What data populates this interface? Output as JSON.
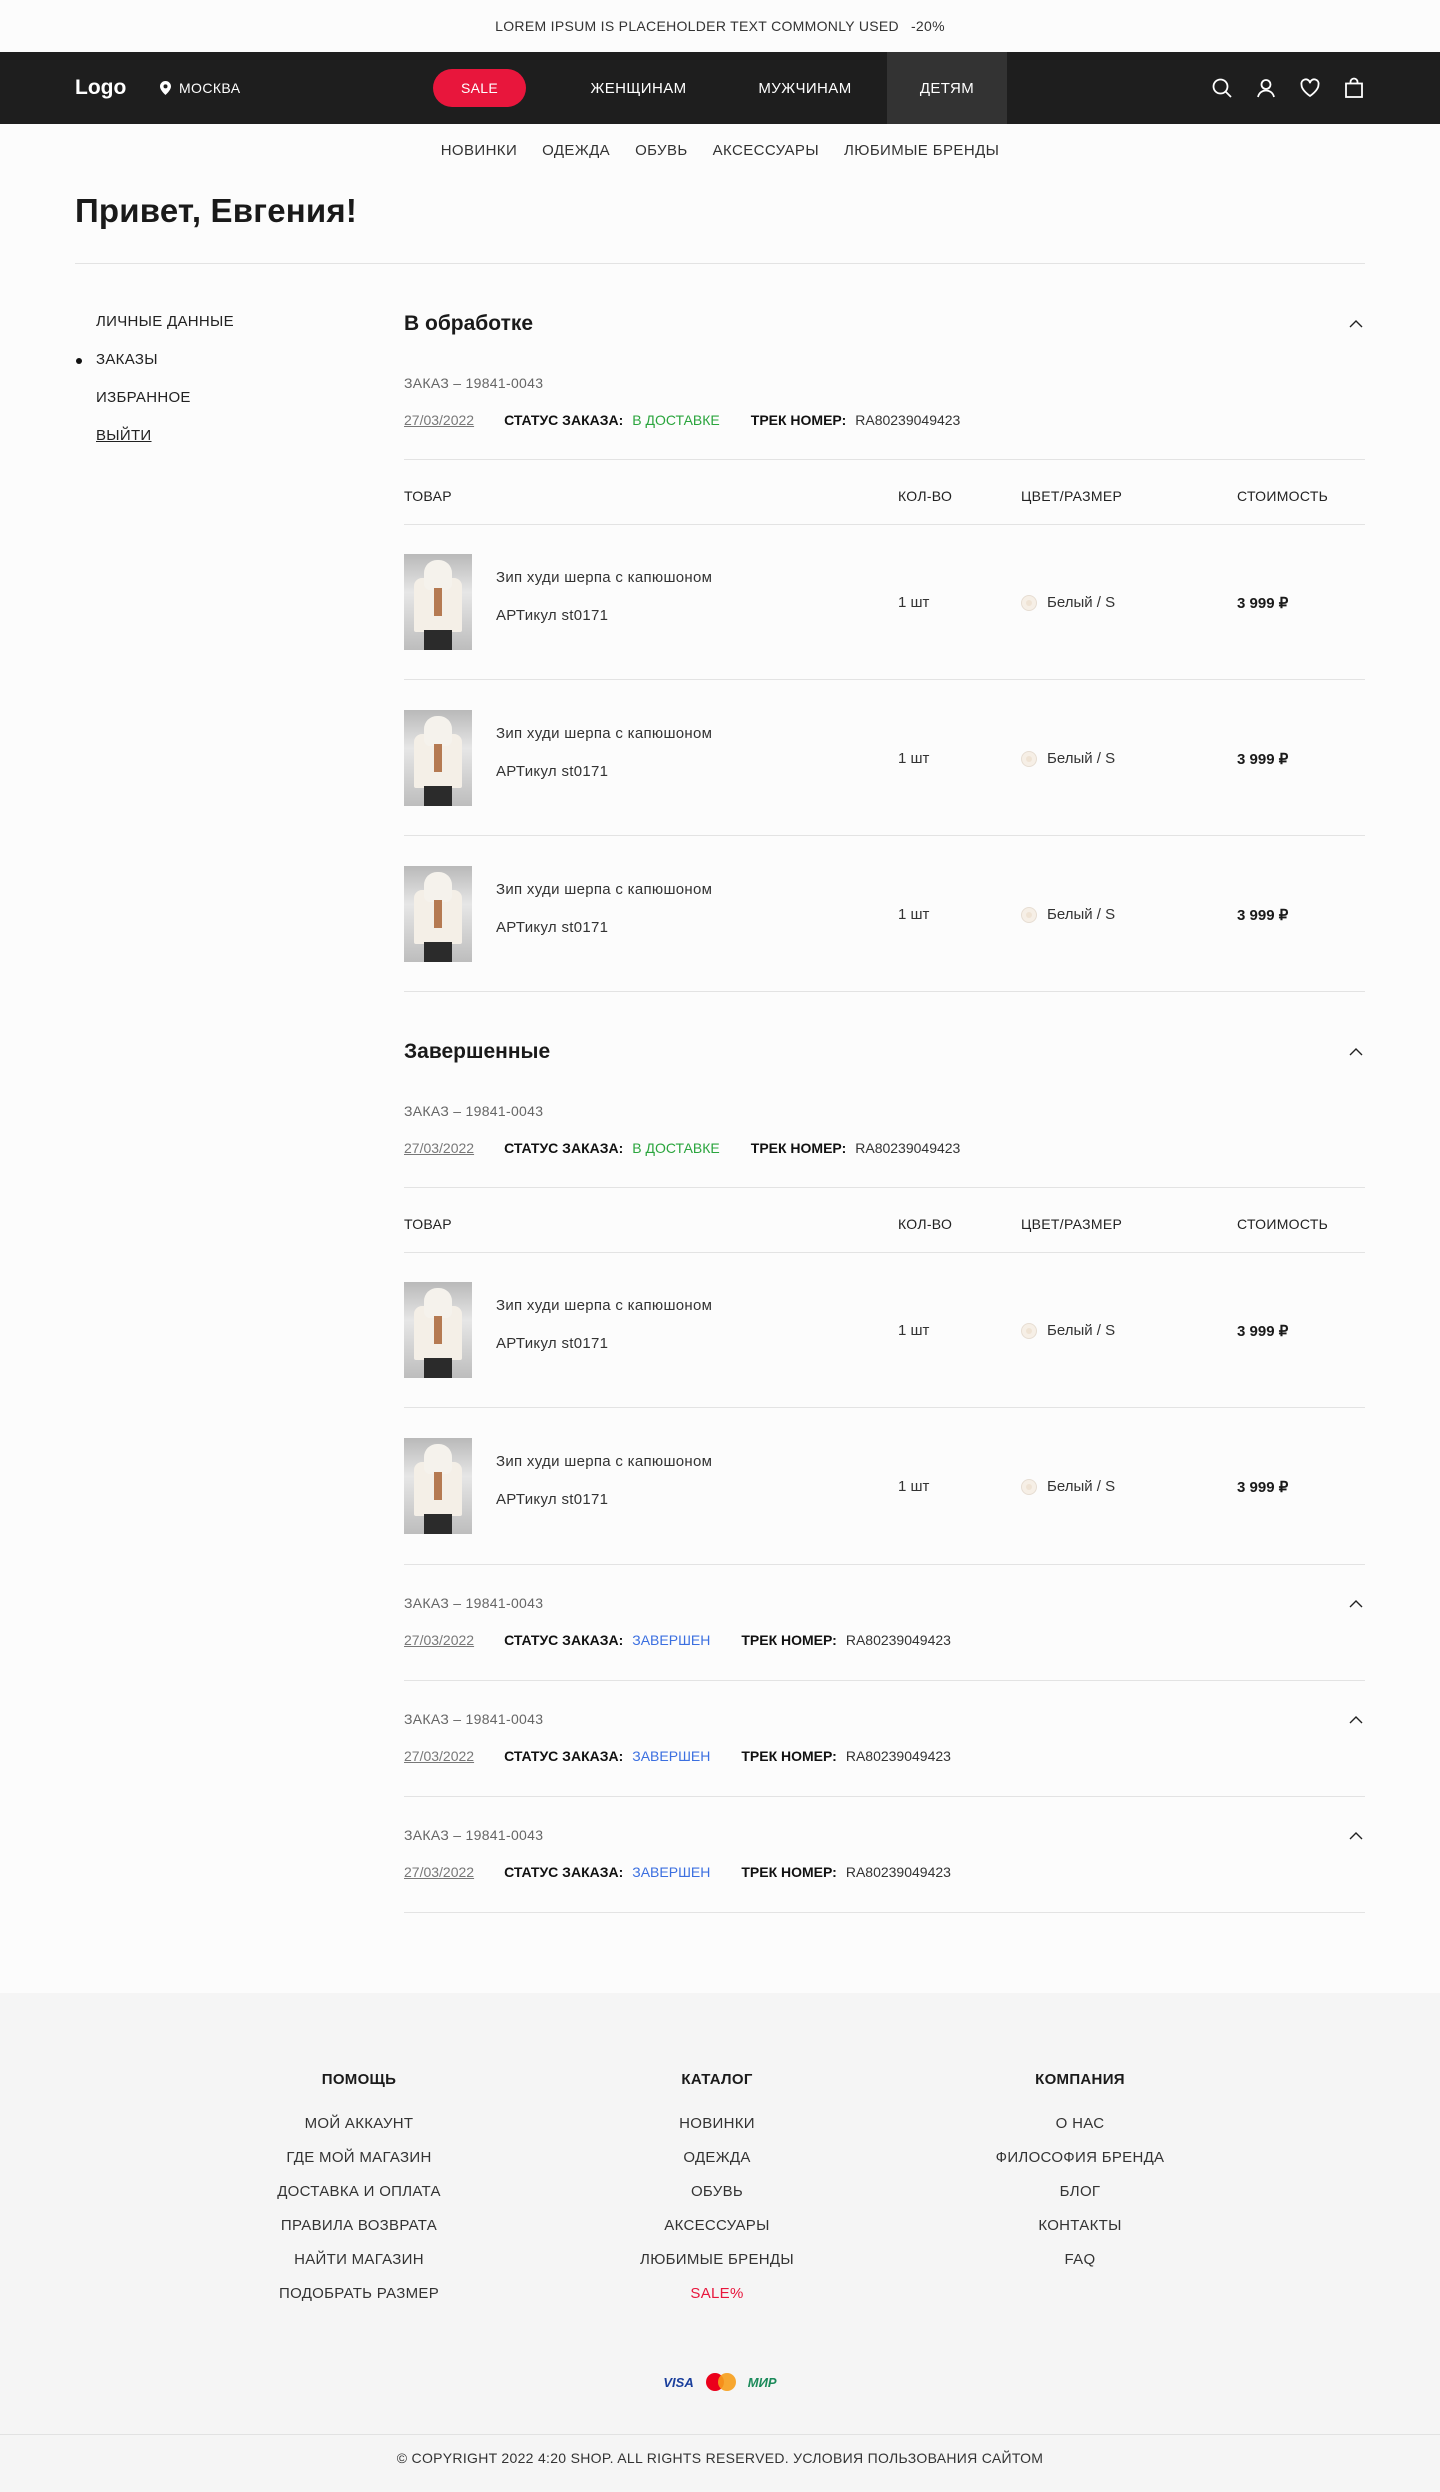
{
  "promo": {
    "text": "LOREM IPSUM IS PLACEHOLDER TEXT COMMONLY USED",
    "discount": "-20%"
  },
  "header": {
    "logo": "Logo",
    "city": "МОСКВА",
    "nav": {
      "sale": "SALE",
      "women": "ЖЕНЩИНАМ",
      "men": "МУЖЧИНАМ",
      "kids": "ДЕТЯМ"
    }
  },
  "subnav": [
    "НОВИНКИ",
    "ОДЕЖДА",
    "ОБУВЬ",
    "АКСЕССУАРЫ",
    "ЛЮБИМЫЕ БРЕНДЫ"
  ],
  "greeting": "Привет, Евгения!",
  "sidebar": {
    "personal": "ЛИЧНЫЕ ДАННЫЕ",
    "orders": "ЗАКАЗЫ",
    "favorites": "ИЗБРАННОЕ",
    "logout": "ВЫЙТИ"
  },
  "labels": {
    "status": "СТАТУС ЗАКАЗА:",
    "track": "ТРЕК НОМЕР:"
  },
  "table_headers": {
    "product": "ТОВАР",
    "qty": "КОЛ-ВО",
    "color_size": "ЦВЕТ/РАЗМЕР",
    "price": "СТОИМОСТЬ"
  },
  "product": {
    "name": "Зип худи шерпа с капюшоном",
    "article": "АРТикул   st0171",
    "qty": "1 шт",
    "color_size": "Белый / S",
    "price": "3 999 ₽"
  },
  "processing": {
    "title": "В обработке",
    "order": {
      "number": "ЗАКАЗ – 19841-0043",
      "date": "27/03/2022",
      "status": "В ДОСТАВКЕ",
      "track": "RA80239049423"
    }
  },
  "completed": {
    "title": "Завершенные",
    "order": {
      "number": "ЗАКАЗ – 19841-0043",
      "date": "27/03/2022",
      "status": "В ДОСТАВКЕ",
      "track": "RA80239049423"
    },
    "collapsed": [
      {
        "number": "ЗАКАЗ – 19841-0043",
        "date": "27/03/2022",
        "status": "ЗАВЕРШЕН",
        "track": "RA80239049423"
      },
      {
        "number": "ЗАКАЗ – 19841-0043",
        "date": "27/03/2022",
        "status": "ЗАВЕРШЕН",
        "track": "RA80239049423"
      },
      {
        "number": "ЗАКАЗ – 19841-0043",
        "date": "27/03/2022",
        "status": "ЗАВЕРШЕН",
        "track": "RA80239049423"
      }
    ]
  },
  "footer": {
    "help": {
      "title": "ПОМОЩЬ",
      "links": [
        "МОЙ АККАУНТ",
        "ГДЕ МОЙ МАГАЗИН",
        "ДОСТАВКА И ОПЛАТА",
        "ПРАВИЛА ВОЗВРАТА",
        "НАЙТИ МАГАЗИН",
        "ПОДОБРАТЬ РАЗМЕР"
      ]
    },
    "catalog": {
      "title": "КАТАЛОГ",
      "links": [
        "НОВИНКИ",
        "ОДЕЖДА",
        "ОБУВЬ",
        "АКСЕССУАРЫ",
        "ЛЮБИМЫЕ БРЕНДЫ",
        "SALE%"
      ]
    },
    "company": {
      "title": "КОМПАНИЯ",
      "links": [
        "О НАС",
        "ФИЛОСОФИЯ БРЕНДА",
        "БЛОГ",
        "КОНТАКТЫ",
        "FAQ"
      ]
    },
    "payments": {
      "visa": "VISA",
      "mir": "МИР"
    },
    "copyright": "© COPYRIGHT 2022 4:20 SHOP. ALL RIGHTS RESERVED. УСЛОВИЯ ПОЛЬЗОВАНИЯ САЙТОМ"
  },
  "colors": {
    "sale": "#e8163c",
    "status_delivery": "#2aa53d",
    "status_done": "#3b6fe0",
    "header_bg": "#1e1e1e"
  }
}
